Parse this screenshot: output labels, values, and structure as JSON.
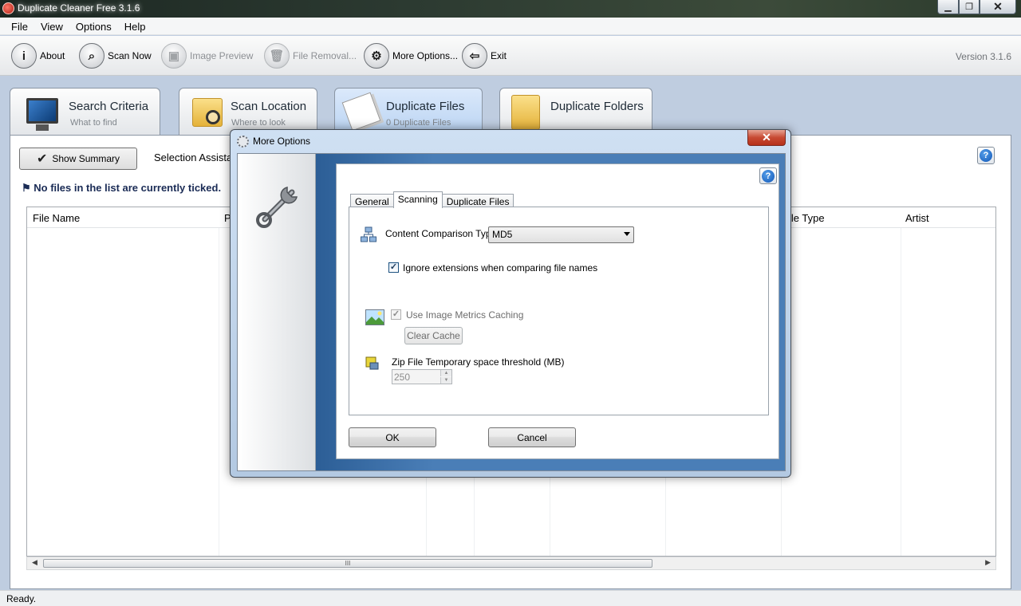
{
  "window": {
    "title": "Duplicate Cleaner Free 3.1.6",
    "minimize": "▁",
    "maximize": "❐",
    "close": "✕"
  },
  "menu": [
    "File",
    "View",
    "Options",
    "Help"
  ],
  "toolbar": {
    "items": [
      {
        "label": "About",
        "icon": "info-icon",
        "glyph": "i",
        "enabled": true
      },
      {
        "label": "Scan Now",
        "icon": "magnifier-icon",
        "glyph": "⌕",
        "enabled": true
      },
      {
        "label": "Image Preview",
        "icon": "image-icon",
        "glyph": "▣",
        "enabled": false
      },
      {
        "label": "File Removal...",
        "icon": "trash-icon",
        "glyph": "🗑",
        "enabled": false
      },
      {
        "label": "More Options...",
        "icon": "gear-icon",
        "glyph": "⚙",
        "enabled": true
      },
      {
        "label": "Exit",
        "icon": "exit-icon",
        "glyph": "⇦",
        "enabled": true
      }
    ],
    "version": "Version 3.1.6"
  },
  "tabs": [
    {
      "title": "Search Criteria",
      "subtitle": "What to find",
      "icon": "monitor-icon"
    },
    {
      "title": "Scan Location",
      "subtitle": "Where to look",
      "icon": "folder-search-icon"
    },
    {
      "title": "Duplicate Files",
      "subtitle": "0 Duplicate Files",
      "icon": "documents-icon",
      "active": true
    },
    {
      "title": "Duplicate Folders",
      "subtitle": "",
      "icon": "folders-icon"
    }
  ],
  "main": {
    "show_summary": "Show Summary",
    "selection_assistant": "Selection Assista",
    "no_files_message": "No files in the list are currently ticked.",
    "help_glyph": "?",
    "columns": [
      "File Name",
      "P",
      "ile Type",
      "Artist"
    ],
    "scroll_thumb_glyph": "III"
  },
  "status": "Ready.",
  "dialog": {
    "title": "More Options",
    "close": "✕",
    "help_glyph": "?",
    "tabs": [
      "General",
      "Scanning",
      "Duplicate Files"
    ],
    "active_tab": "Scanning",
    "content_comparison_label": "Content Comparison Type",
    "content_comparison_value": "MD5",
    "ignore_extensions_label": "Ignore extensions when comparing file names",
    "ignore_extensions_checked": true,
    "image_metrics_label": "Use Image Metrics Caching",
    "image_metrics_checked": true,
    "clear_cache": "Clear Cache",
    "zip_threshold_label": "Zip File Temporary space threshold (MB)",
    "zip_threshold_value": "250",
    "ok": "OK",
    "cancel": "Cancel"
  },
  "colors": {
    "accent": "#4a7eb7",
    "close_red": "#c74a33",
    "tab_active": "#b9d3f2"
  }
}
